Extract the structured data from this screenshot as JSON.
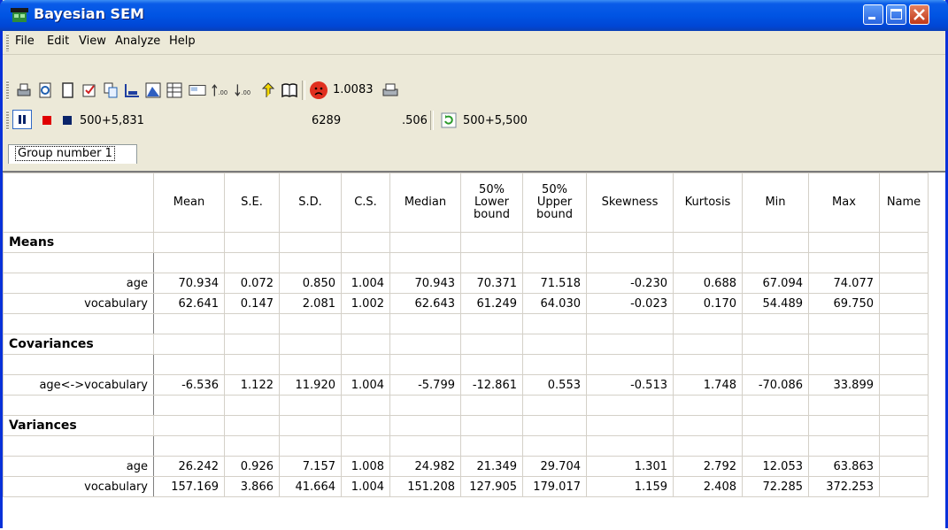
{
  "window": {
    "title": "Bayesian SEM"
  },
  "menubar": [
    "File",
    "Edit",
    "View",
    "Analyze",
    "Help"
  ],
  "toolbar": {
    "convergence_value": "1.0083"
  },
  "statusbar": {
    "samples": "500+5,831",
    "count": "6289",
    "rate": ".506",
    "refresh_samples": "500+5,500"
  },
  "tab": {
    "label": "Group number 1"
  },
  "table": {
    "columns": [
      "Mean",
      "S.E.",
      "S.D.",
      "C.S.",
      "Median",
      "50% Lower bound",
      "50% Upper bound",
      "Skewness",
      "Kurtosis",
      "Min",
      "Max",
      "Name"
    ],
    "sections": [
      {
        "title": "Means",
        "rows": [
          {
            "label": "age",
            "values": [
              "70.934",
              "0.072",
              "0.850",
              "1.004",
              "70.943",
              "70.371",
              "71.518",
              "-0.230",
              "0.688",
              "67.094",
              "74.077",
              ""
            ]
          },
          {
            "label": "vocabulary",
            "values": [
              "62.641",
              "0.147",
              "2.081",
              "1.002",
              "62.643",
              "61.249",
              "64.030",
              "-0.023",
              "0.170",
              "54.489",
              "69.750",
              ""
            ]
          }
        ]
      },
      {
        "title": "Covariances",
        "rows": [
          {
            "label": "age<->vocabulary",
            "values": [
              "-6.536",
              "1.122",
              "11.920",
              "1.004",
              "-5.799",
              "-12.861",
              "0.553",
              "-0.513",
              "1.748",
              "-70.086",
              "33.899",
              ""
            ]
          }
        ]
      },
      {
        "title": "Variances",
        "rows": [
          {
            "label": "age",
            "values": [
              "26.242",
              "0.926",
              "7.157",
              "1.008",
              "24.982",
              "21.349",
              "29.704",
              "1.301",
              "2.792",
              "12.053",
              "63.863",
              ""
            ]
          },
          {
            "label": "vocabulary",
            "values": [
              "157.169",
              "3.866",
              "41.664",
              "1.004",
              "151.208",
              "127.905",
              "179.017",
              "1.159",
              "2.408",
              "72.285",
              "372.253",
              ""
            ]
          }
        ]
      }
    ]
  }
}
